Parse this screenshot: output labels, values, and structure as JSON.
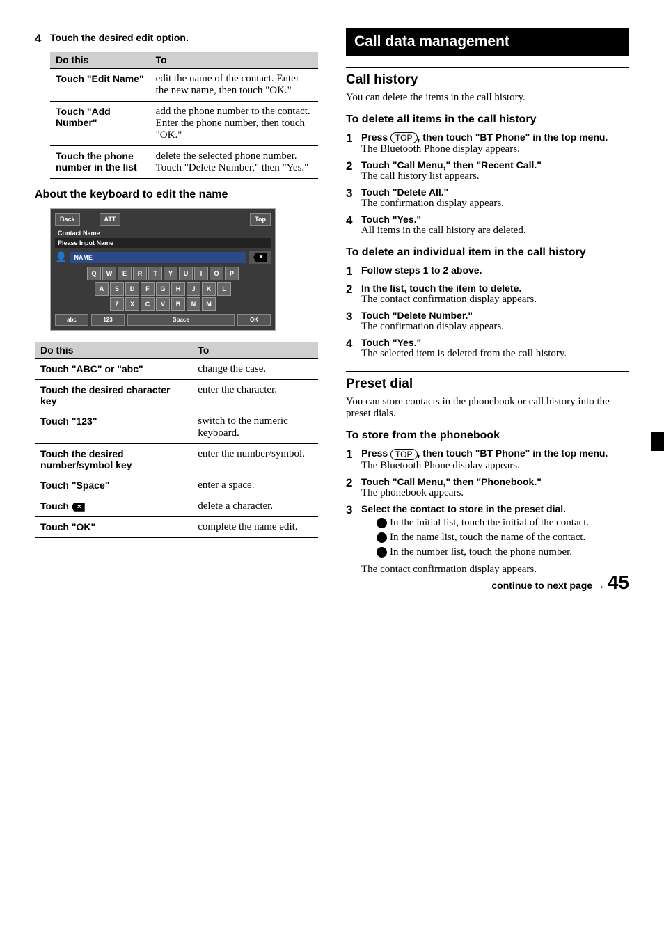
{
  "left": {
    "step4": {
      "num": "4",
      "text": "Touch the desired edit option."
    },
    "table1": {
      "head": {
        "a": "Do this",
        "b": "To"
      },
      "rows": [
        {
          "a": "Touch \"Edit Name\"",
          "b": "edit the name of the contact. Enter the new name, then touch \"OK.\""
        },
        {
          "a": "Touch \"Add Number\"",
          "b": "add the phone number to the contact. Enter the phone number, then touch \"OK.\""
        },
        {
          "a": "Touch the phone number in the list",
          "b": "delete the selected phone number. Touch \"Delete Number,\" then \"Yes.\""
        }
      ]
    },
    "kbhead": "About the keyboard to edit the name",
    "kb": {
      "back": "Back",
      "att": "ATT",
      "top": "Top",
      "contact_name": "Contact Name",
      "please_input": "Please Input Name",
      "name_field": "NAME_",
      "row1": [
        "Q",
        "W",
        "E",
        "R",
        "T",
        "Y",
        "U",
        "I",
        "O",
        "P"
      ],
      "row2": [
        "A",
        "S",
        "D",
        "F",
        "G",
        "H",
        "J",
        "K",
        "L"
      ],
      "row3": [
        "Z",
        "X",
        "C",
        "V",
        "B",
        "N",
        "M"
      ],
      "abc": "abc",
      "num": "123",
      "space": "Space",
      "ok": "OK"
    },
    "table2": {
      "head": {
        "a": "Do this",
        "b": "To"
      },
      "rows": [
        {
          "a": "Touch \"ABC\" or \"abc\"",
          "b": "change the case."
        },
        {
          "a": "Touch the desired character key",
          "b": "enter the character."
        },
        {
          "a": "Touch \"123\"",
          "b": "switch to the numeric keyboard."
        },
        {
          "a": "Touch the desired number/symbol key",
          "b": "enter the number/symbol."
        },
        {
          "a": "Touch \"Space\"",
          "b": "enter a space."
        },
        {
          "a_prefix": "Touch ",
          "a_icon": true,
          "b": "delete a character."
        },
        {
          "a": "Touch \"OK\"",
          "b": "complete the name edit."
        }
      ]
    }
  },
  "right": {
    "banner": "Call data management",
    "section1": {
      "title": "Call history",
      "intro": "You can delete the items in the call history.",
      "sub1": {
        "title": "To delete all items in the call history",
        "steps": [
          {
            "n": "1",
            "bold_pre": "Press ",
            "top": "TOP",
            "bold_post": ", then touch \"BT Phone\" in the top menu.",
            "reg": "The Bluetooth Phone display appears."
          },
          {
            "n": "2",
            "bold": "Touch \"Call Menu,\" then \"Recent Call.\"",
            "reg": "The call history list appears."
          },
          {
            "n": "3",
            "bold": "Touch \"Delete All.\"",
            "reg": "The confirmation display appears."
          },
          {
            "n": "4",
            "bold": "Touch \"Yes.\"",
            "reg": "All items in the call history are deleted."
          }
        ]
      },
      "sub2": {
        "title": "To delete an individual item in the call history",
        "steps": [
          {
            "n": "1",
            "bold": "Follow steps 1 to 2 above."
          },
          {
            "n": "2",
            "bold": "In the list, touch the item to delete.",
            "reg": "The contact confirmation display appears."
          },
          {
            "n": "3",
            "bold": "Touch \"Delete Number.\"",
            "reg": "The confirmation display appears."
          },
          {
            "n": "4",
            "bold": "Touch \"Yes.\"",
            "reg": "The selected item is deleted from the call history."
          }
        ]
      }
    },
    "section2": {
      "title": "Preset dial",
      "intro": "You can store contacts in the phonebook or call history into the preset dials.",
      "sub1": {
        "title": "To store from the phonebook",
        "steps": [
          {
            "n": "1",
            "bold_pre": "Press ",
            "top": "TOP",
            "bold_post": ", then touch \"BT Phone\" in the top menu.",
            "reg": "The Bluetooth Phone display appears."
          },
          {
            "n": "2",
            "bold": "Touch \"Call Menu,\" then \"Phonebook.\"",
            "reg": "The phonebook appears."
          },
          {
            "n": "3",
            "bold": "Select the contact to store in the preset dial.",
            "subs": [
              "In the initial list, touch the initial of the contact.",
              "In the name list, touch the name of the contact.",
              "In the number list, touch the phone number."
            ],
            "tail": "The contact confirmation display appears."
          }
        ]
      }
    }
  },
  "footer": {
    "text": "continue to next page ",
    "arrow": "→",
    "page": "45"
  }
}
